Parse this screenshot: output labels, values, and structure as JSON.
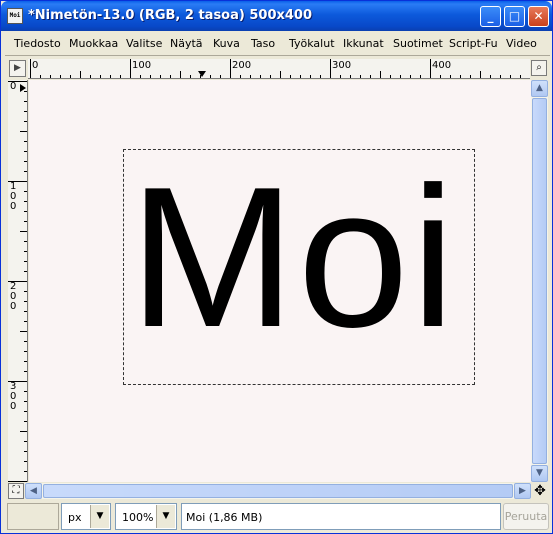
{
  "window": {
    "title": "*Nimetön-13.0 (RGB, 2 tasoa) 500x400",
    "icon_text": "Moi"
  },
  "titlebar": {
    "minimize": "_",
    "maximize": "□",
    "close": "✕"
  },
  "menu": [
    "Tiedosto",
    "Muokkaa",
    "Valitse",
    "Näytä",
    "Kuva",
    "Taso",
    "Työkalut",
    "Ikkunat",
    "Suotimet",
    "Script-Fu",
    "Video"
  ],
  "rulers": {
    "h_labels": [
      "0",
      "100",
      "200",
      "300",
      "400"
    ],
    "v_labels": [
      "0",
      "100",
      "200",
      "300"
    ]
  },
  "canvas": {
    "text": "Moi",
    "background": "#faf4f4"
  },
  "statusbar": {
    "unit": "px",
    "zoom": "100%",
    "message": "Moi (1,86 MB)",
    "cancel": "Peruuta"
  }
}
